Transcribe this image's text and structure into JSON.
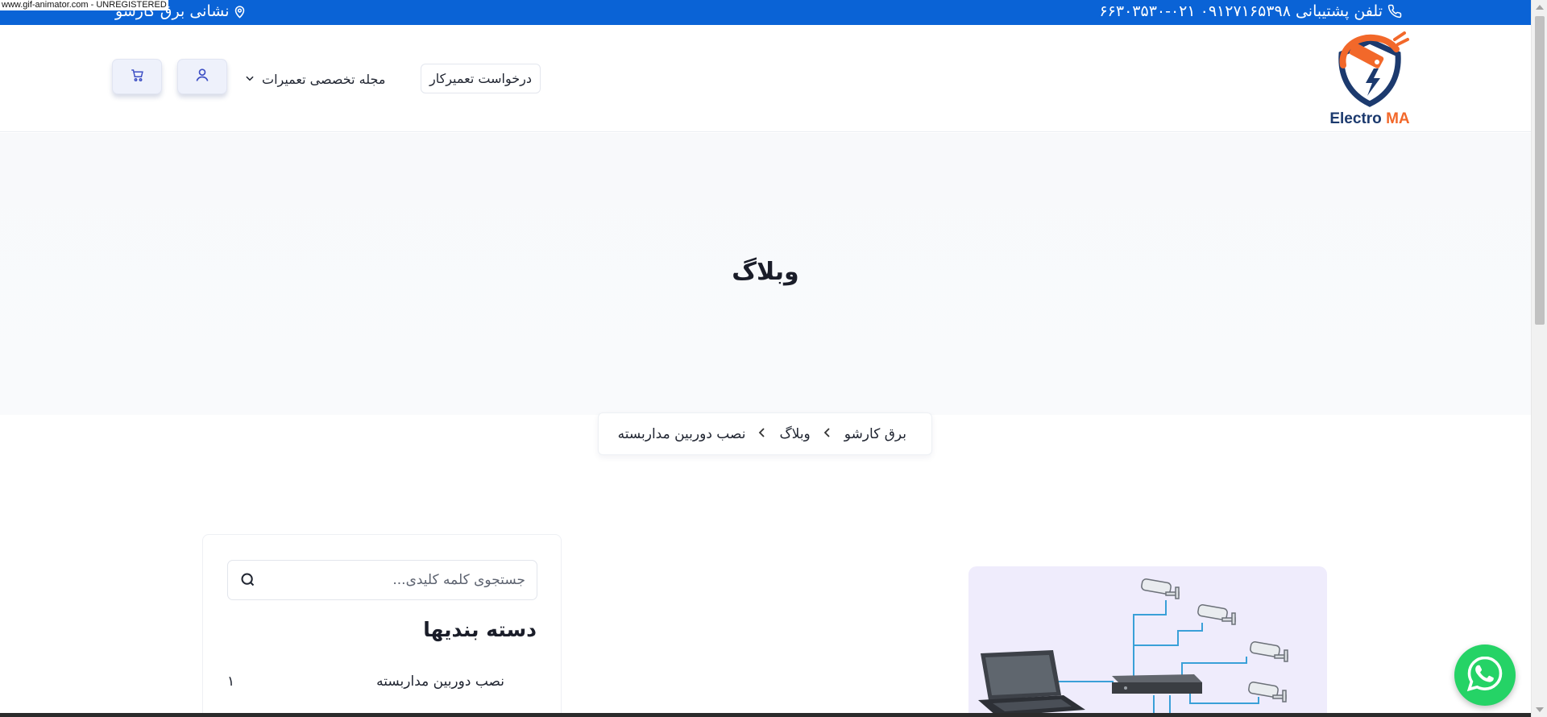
{
  "watermark": "www.gif-animator.com - UNREGISTERED",
  "topbar": {
    "phones": "تلفن پشتیبانی ۰۹۱۲۷۱۶۵۳۹۸   ۰۲۱-۶۶۳۰۳۵۳۰",
    "address": "نشانی برق کارشو",
    "phone_icon": "phone-icon",
    "location_icon": "location-pin-icon",
    "color": "#0a63d6"
  },
  "header": {
    "logo_text_main": "Electro",
    "logo_text_accent": "MA",
    "request_button": "درخواست تعمیرکار",
    "magazine_menu": "مجله تخصصی تعمیرات",
    "user_icon": "user-icon",
    "cart_icon": "cart-icon"
  },
  "hero": {
    "title": "وبلاگ"
  },
  "breadcrumb": {
    "items": [
      "برق کارشو",
      "وبلاگ",
      "نصب دوربین مداربسته"
    ]
  },
  "sidebar": {
    "search_placeholder": "جستجوی کلمه کلیدی...",
    "categories_title": "دسته بندیها",
    "categories": [
      {
        "label": "نصب دوربین مداربسته",
        "count": "۱"
      }
    ]
  },
  "colors": {
    "primary": "#0a63d6",
    "logo_orange": "#f2682a",
    "logo_navy": "#1c3a6e",
    "whatsapp": "#25d366"
  }
}
